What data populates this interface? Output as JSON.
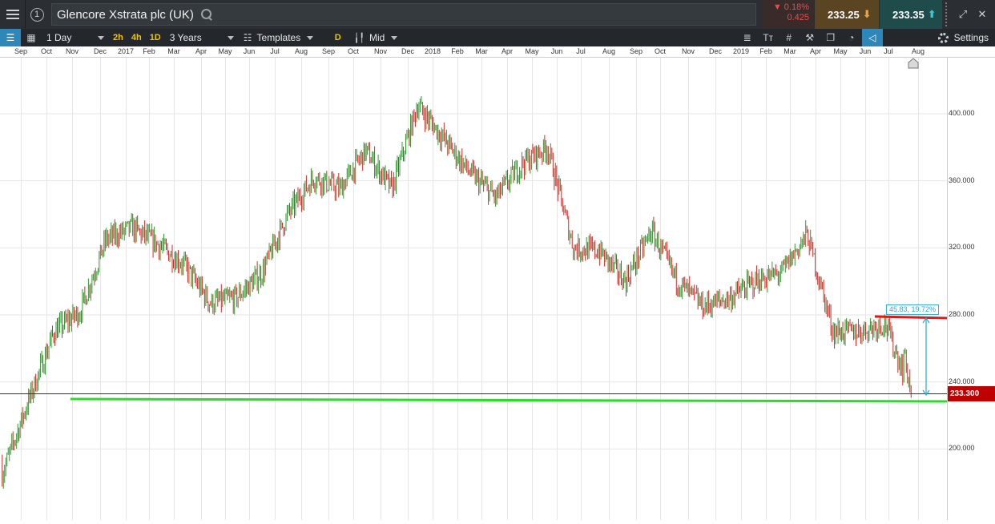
{
  "header": {
    "title": "Glencore Xstrata plc (UK)",
    "info_icon": "info-circle-icon",
    "search_icon": "search-icon",
    "change_pct": "▼ 0.18%",
    "change_abs": "0.425",
    "sell_price": "233.25",
    "buy_price": "233.35",
    "colors": {
      "negative": "#e54c4c",
      "sell_bg": "#5a4422",
      "buy_bg": "#1f4b4b"
    }
  },
  "toolbar": {
    "interval": "1 Day",
    "quick_intervals": [
      "2h",
      "4h",
      "1D"
    ],
    "range": "3 Years",
    "templates_label": "Templates",
    "d_label": "D",
    "price_type": "Mid",
    "tools": [
      "align-icon",
      "text-icon",
      "crosshair-icon",
      "drawing-tools-icon",
      "layers-icon",
      "indicator-icon",
      "tag-icon"
    ],
    "settings_label": "Settings"
  },
  "time_axis": {
    "labels": [
      "Sep",
      "Oct",
      "Nov",
      "Dec",
      "2017",
      "Feb",
      "Mar",
      "Apr",
      "May",
      "Jun",
      "Jul",
      "Aug",
      "Sep",
      "Oct",
      "Nov",
      "Dec",
      "2018",
      "Feb",
      "Mar",
      "Apr",
      "May",
      "Jun",
      "Jul",
      "Aug",
      "Sep",
      "Oct",
      "Nov",
      "Dec",
      "2019",
      "Feb",
      "Mar",
      "Apr",
      "May",
      "Jun",
      "Jul",
      "Aug"
    ]
  },
  "price_axis": {
    "labels": [
      "400.000",
      "360.000",
      "320.000",
      "280.000",
      "240.000",
      "200.000"
    ],
    "current_price": "233.300"
  },
  "annotations": {
    "measure_label": "45.83, 19.72%",
    "support_color": "#23e023",
    "resistance_color": "#e01818",
    "measure_color": "#27a7d3"
  },
  "chart_data": {
    "type": "candlestick",
    "instrument": "Glencore Xstrata plc (UK)",
    "interval": "1 Day",
    "x_range": [
      "2016-09",
      "2019-08"
    ],
    "ylim": [
      170,
      430
    ],
    "grid": true,
    "last_price": 233.3,
    "support_line": 229,
    "resistance_line": 279,
    "measure": {
      "from": 279.13,
      "to": 233.3,
      "change": 45.83,
      "change_pct": 19.72
    },
    "monthly_closes": [
      {
        "x": "2016-09",
        "y": 185
      },
      {
        "x": "2016-10",
        "y": 228
      },
      {
        "x": "2016-11",
        "y": 270
      },
      {
        "x": "2016-12",
        "y": 282
      },
      {
        "x": "2017-01",
        "y": 325
      },
      {
        "x": "2017-02",
        "y": 332
      },
      {
        "x": "2017-03",
        "y": 322
      },
      {
        "x": "2017-04",
        "y": 310
      },
      {
        "x": "2017-05",
        "y": 287
      },
      {
        "x": "2017-06",
        "y": 290
      },
      {
        "x": "2017-07",
        "y": 305
      },
      {
        "x": "2017-08",
        "y": 340
      },
      {
        "x": "2017-09",
        "y": 362
      },
      {
        "x": "2017-10",
        "y": 355
      },
      {
        "x": "2017-11",
        "y": 378
      },
      {
        "x": "2017-12",
        "y": 355
      },
      {
        "x": "2018-01",
        "y": 405
      },
      {
        "x": "2018-02",
        "y": 385
      },
      {
        "x": "2018-03",
        "y": 365
      },
      {
        "x": "2018-04",
        "y": 350
      },
      {
        "x": "2018-05",
        "y": 370
      },
      {
        "x": "2018-06",
        "y": 380
      },
      {
        "x": "2018-07",
        "y": 320
      },
      {
        "x": "2018-08",
        "y": 318
      },
      {
        "x": "2018-09",
        "y": 300
      },
      {
        "x": "2018-10",
        "y": 330
      },
      {
        "x": "2018-11",
        "y": 300
      },
      {
        "x": "2018-12",
        "y": 285
      },
      {
        "x": "2019-01",
        "y": 290
      },
      {
        "x": "2019-02",
        "y": 300
      },
      {
        "x": "2019-03",
        "y": 305
      },
      {
        "x": "2019-04",
        "y": 328
      },
      {
        "x": "2019-05",
        "y": 270
      },
      {
        "x": "2019-06",
        "y": 270
      },
      {
        "x": "2019-07",
        "y": 275
      },
      {
        "x": "2019-08",
        "y": 233.3
      }
    ]
  }
}
